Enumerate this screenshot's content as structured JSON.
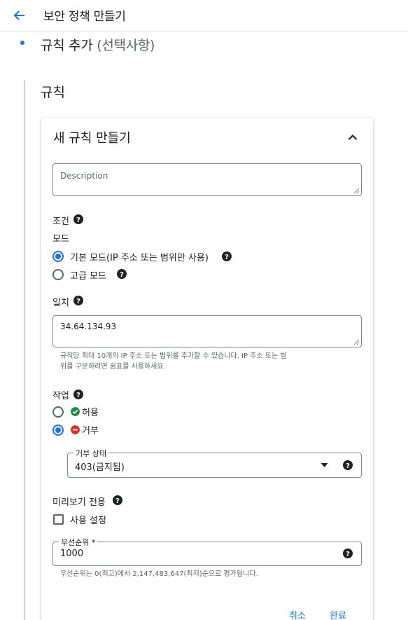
{
  "header": {
    "title": "보안 정책 만들기",
    "back_icon": "arrow-back-icon"
  },
  "step": {
    "title": "규칙 추가",
    "optional": "(선택사항)"
  },
  "rules_section": {
    "heading": "규칙"
  },
  "card": {
    "title": "새 규칙 만들기",
    "description": {
      "placeholder": "Description",
      "value": ""
    },
    "condition_label": "조건",
    "mode": {
      "label": "모드",
      "options": [
        {
          "label": "기본 모드(IP 주소 또는 범위만 사용)",
          "selected": true
        },
        {
          "label": "고급 모드",
          "selected": false
        }
      ]
    },
    "match": {
      "label": "일치",
      "value": "34.64.134.93",
      "hint_line1": "규칙당 최대 10개의 IP 주소 또는 범위를 추가할 수 있습니다. IP 주소 또는 범",
      "hint_line2": "위를 구분하려면 쉼표를 사용하세요."
    },
    "action": {
      "label": "작업",
      "options": [
        {
          "label": "허용",
          "selected": false,
          "icon": "check-circle-icon",
          "color": "#1e8e3e"
        },
        {
          "label": "거부",
          "selected": true,
          "icon": "deny-circle-icon",
          "color": "#d93025"
        }
      ],
      "deny_status": {
        "label": "거부 상태",
        "value": "403(금지됨)"
      }
    },
    "preview": {
      "label": "미리보기 전용",
      "checkbox_label": "사용 설정",
      "checked": false
    },
    "priority": {
      "label": "우선순위 *",
      "value": "1000",
      "hint": "우선순위는 0(최고)에서 2,147,483,647(최저)순으로 평가됩니다."
    },
    "buttons": {
      "cancel": "취소",
      "done": "완료"
    }
  },
  "colors": {
    "accent": "#1a73e8",
    "allow": "#1e8e3e",
    "deny": "#d93025"
  }
}
